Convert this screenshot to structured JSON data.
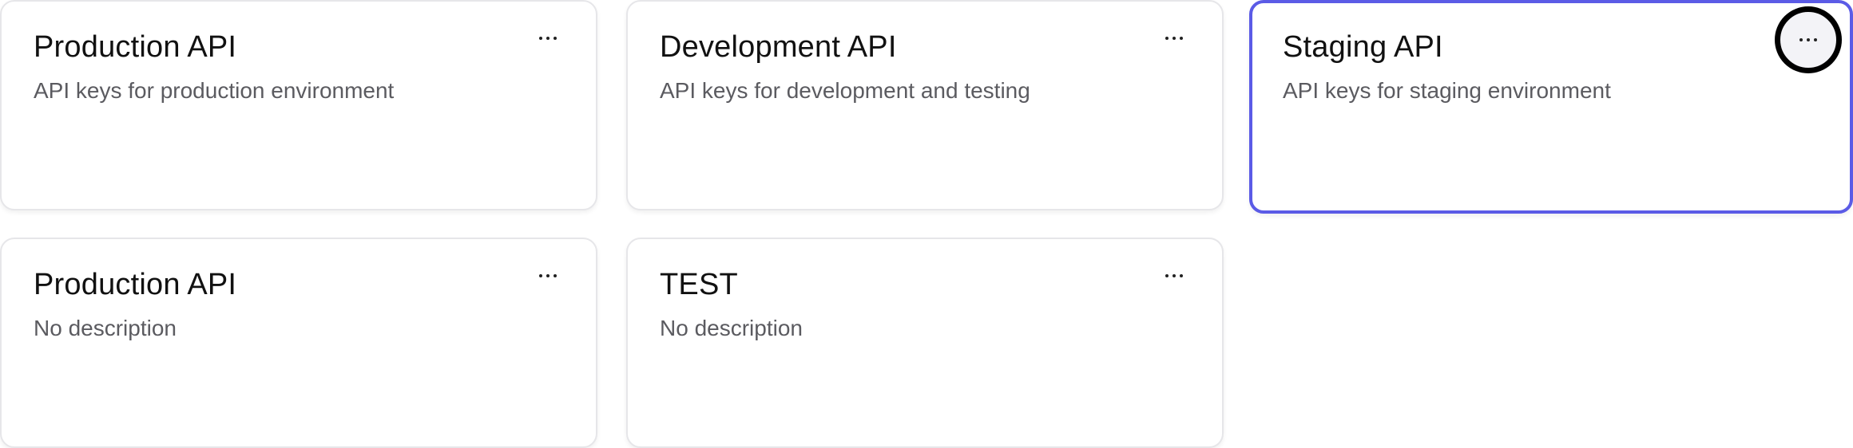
{
  "cards": [
    {
      "title": "Production API",
      "description": "API keys for production environment",
      "selected": false,
      "menu_icon": "more-horizontal-icon"
    },
    {
      "title": "Development API",
      "description": "API keys for development and testing",
      "selected": false,
      "menu_icon": "more-horizontal-icon"
    },
    {
      "title": "Staging API",
      "description": "API keys for staging environment",
      "selected": true,
      "menu_icon": "more-horizontal-icon"
    },
    {
      "title": "Production API",
      "description": "No description",
      "selected": false,
      "menu_icon": "more-horizontal-icon"
    },
    {
      "title": "TEST",
      "description": "No description",
      "selected": false,
      "menu_icon": "more-horizontal-icon"
    }
  ],
  "colors": {
    "accent": "#5b5be6",
    "border": "#e6e6e9",
    "title": "#111111",
    "description": "#5b5b60"
  }
}
